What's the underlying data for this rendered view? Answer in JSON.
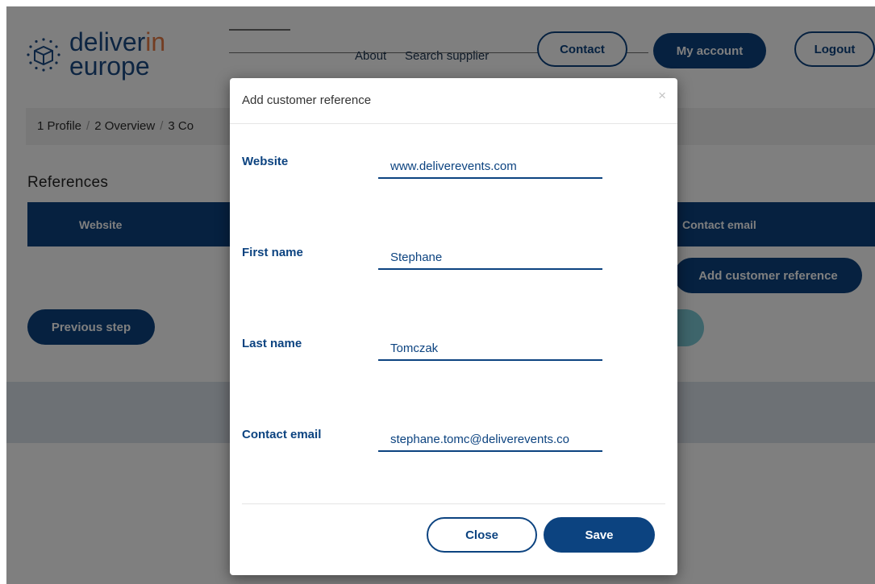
{
  "brand": {
    "line1_main": "deliver",
    "line1_accent": "in",
    "line2": "europe",
    "accent_color": "#e77b45",
    "primary_color": "#0c4380"
  },
  "nav": {
    "about": "About",
    "search_supplier": "Search supplier",
    "contact": "Contact",
    "my_account": "My account",
    "logout": "Logout"
  },
  "breadcrumb": {
    "items": [
      "1 Profile",
      "2 Overview",
      "3 Co"
    ]
  },
  "references": {
    "title": "References",
    "columns": [
      "Website",
      "Contact email"
    ],
    "add_button": "Add customer reference",
    "previous_button": "Previous step"
  },
  "modal": {
    "title": "Add customer reference",
    "close_symbol": "×",
    "fields": [
      {
        "label": "Website",
        "value": "www.deliverevents.com"
      },
      {
        "label": "First name",
        "value": "Stephane"
      },
      {
        "label": "Last name",
        "value": "Tomczak"
      },
      {
        "label": "Contact email",
        "value": "stephane.tomc@deliverevents.co"
      }
    ],
    "close_button": "Close",
    "save_button": "Save"
  }
}
